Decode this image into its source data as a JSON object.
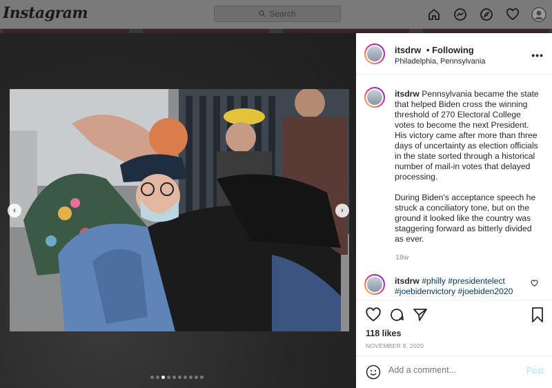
{
  "topbar": {
    "logo": "Instagram",
    "search_placeholder": "Search"
  },
  "post": {
    "username": "itsdrw",
    "follow_status": "• Following",
    "location": "Philadelphia, Pennsylvania",
    "caption_p1": "Pennsylvania became the state that helped Biden cross the winning threshold of 270 Electoral College votes to become the next President. His victory came after more than three days of uncertainty as election officials in the state sorted through a historical number of mail-in votes that delayed processing.",
    "caption_p2": "During Biden's acceptance speech he struck a conciliatory tone, but on the ground it looked like the country was staggering forward as bitterly divided as ever.",
    "caption_age": "18w",
    "comment_user": "itsdrw",
    "comment_tags": "#philly #presidentelect #joebidenvictory #joebiden2020",
    "likes": "118 likes",
    "date": "NOVEMBER 8, 2020",
    "add_comment_placeholder": "Add a comment...",
    "post_button": "Post"
  },
  "carousel": {
    "total_slides": 10,
    "current_slide": 3
  },
  "colors": {
    "link": "#00376b",
    "post_disabled": "#b2dffc",
    "muted": "#8e8e8e"
  }
}
